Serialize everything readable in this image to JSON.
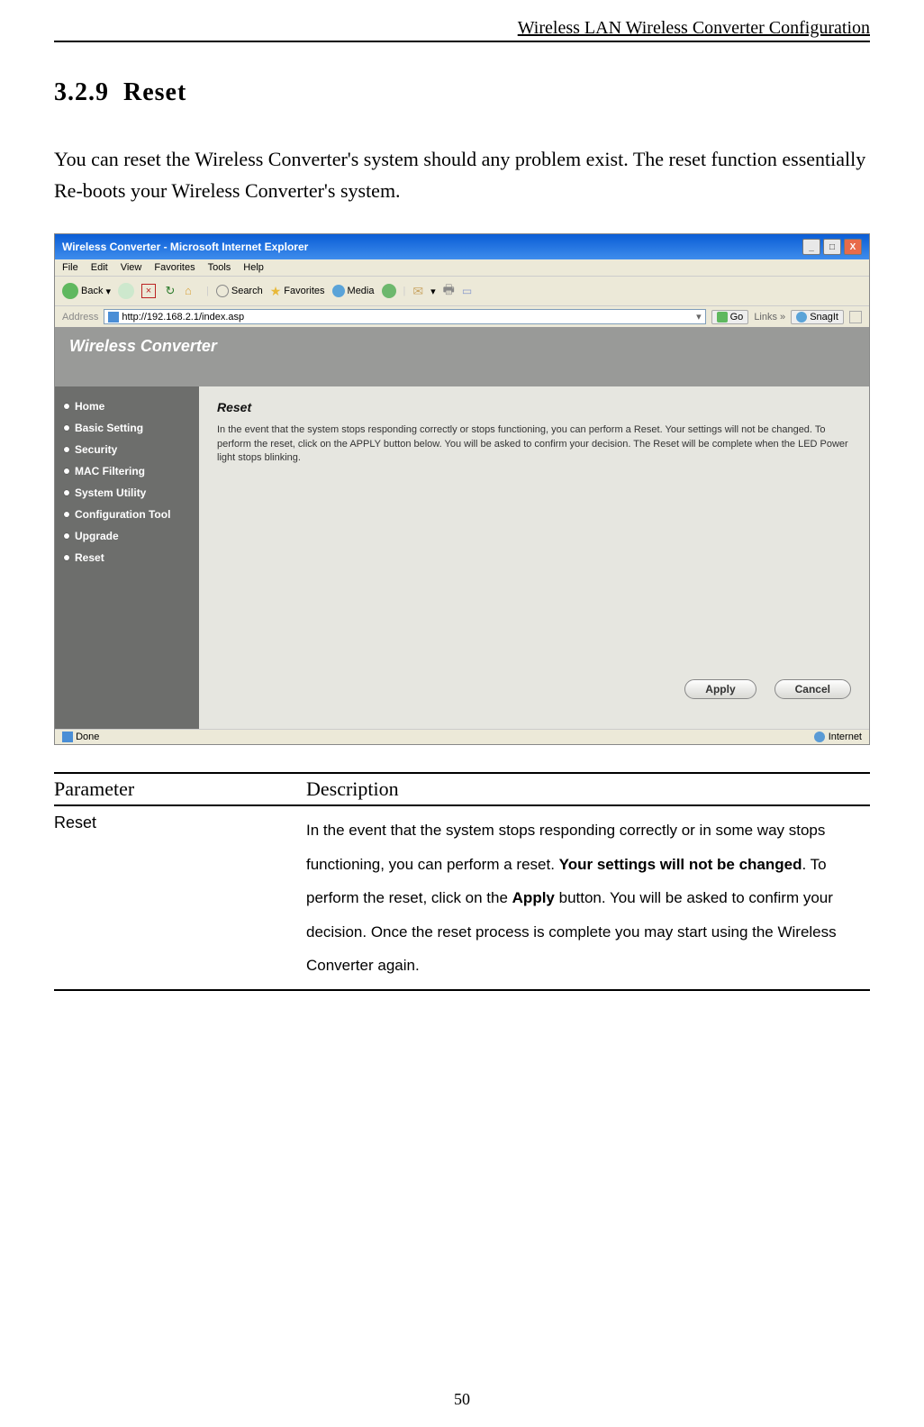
{
  "header": "Wireless LAN Wireless Converter Configuration",
  "section_number": "3.2.9",
  "section_title": "Reset",
  "intro": "You can reset the Wireless Converter's system should any problem exist. The reset function essentially Re-boots your Wireless Converter's system.",
  "screenshot": {
    "window_title": "Wireless Converter - Microsoft Internet Explorer",
    "menubar": [
      "File",
      "Edit",
      "View",
      "Favorites",
      "Tools",
      "Help"
    ],
    "toolbar": {
      "back": "Back",
      "search": "Search",
      "favorites": "Favorites",
      "media": "Media"
    },
    "address_label": "Address",
    "address_url": "http://192.168.2.1/index.asp",
    "go": "Go",
    "links": "Links",
    "snagit": "SnagIt",
    "app_title": "Wireless Converter",
    "sidebar": [
      "Home",
      "Basic Setting",
      "Security",
      "MAC Filtering",
      "System Utility",
      "Configuration Tool",
      "Upgrade",
      "Reset"
    ],
    "content_title": "Reset",
    "content_text": "In the event that the system stops responding correctly or stops functioning, you can perform a Reset. Your settings will not be changed. To perform the reset, click on the APPLY button below. You will be asked to confirm your decision. The Reset will be complete when the LED Power light stops blinking.",
    "apply": "Apply",
    "cancel": "Cancel",
    "status_done": "Done",
    "status_zone": "Internet"
  },
  "table": {
    "header_param": "Parameter",
    "header_desc": "Description",
    "row_param": "Reset",
    "row_desc_1": "In the event that the system stops responding correctly or in some way stops functioning, you can perform a reset. ",
    "row_desc_bold1": "Your settings will not be changed",
    "row_desc_2": ". To perform the reset, click on the ",
    "row_desc_bold2": "Apply",
    "row_desc_3": " button. You will be asked to confirm your decision. Once the reset process is complete you may start using the Wireless Converter again."
  },
  "page_number": "50"
}
